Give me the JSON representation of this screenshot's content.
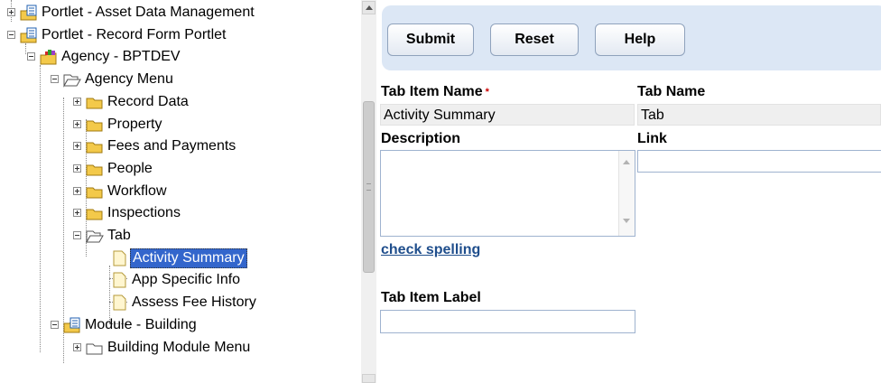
{
  "tree": {
    "nodes": [
      {
        "label": "Portlet - Asset Data Management",
        "icon": "portlet-icon",
        "expander": "plus"
      },
      {
        "label": "Portlet - Record Form Portlet",
        "icon": "portlet-icon",
        "expander": "minus"
      },
      {
        "label": "Agency - BPTDEV",
        "icon": "agency-folder-icon",
        "expander": "minus"
      },
      {
        "label": "Agency Menu",
        "icon": "folder-open-icon",
        "expander": "minus"
      },
      {
        "label": "Record Data",
        "icon": "folder-icon",
        "expander": "plus"
      },
      {
        "label": "Property",
        "icon": "folder-icon",
        "expander": "plus"
      },
      {
        "label": "Fees and Payments",
        "icon": "folder-icon",
        "expander": "plus"
      },
      {
        "label": "People",
        "icon": "folder-icon",
        "expander": "plus"
      },
      {
        "label": "Workflow",
        "icon": "folder-icon",
        "expander": "plus"
      },
      {
        "label": "Inspections",
        "icon": "folder-icon",
        "expander": "plus"
      },
      {
        "label": "Tab",
        "icon": "folder-open-icon",
        "expander": "minus"
      },
      {
        "label": "Activity Summary",
        "icon": "page-icon",
        "selected": true
      },
      {
        "label": "App Specific Info",
        "icon": "page-icon"
      },
      {
        "label": "Assess Fee History",
        "icon": "page-icon"
      },
      {
        "label": "Module - Building",
        "icon": "module-icon",
        "expander": "minus"
      },
      {
        "label": "Building Module Menu",
        "icon": "folder-outline-icon",
        "expander": "plus"
      }
    ]
  },
  "toolbar": {
    "submit_label": "Submit",
    "reset_label": "Reset",
    "help_label": "Help"
  },
  "form": {
    "tab_item_name_label": "Tab Item Name",
    "required_mark": "*",
    "tab_item_name_value": "Activity Summary",
    "tab_name_label": "Tab Name",
    "tab_name_value": "Tab",
    "description_label": "Description",
    "description_value": "",
    "link_label": "Link",
    "link_value": "",
    "check_spelling_label": "check spelling",
    "tab_item_label_label": "Tab Item Label",
    "tab_item_label_value": ""
  },
  "colors": {
    "toolbar_bg": "#dce7f5",
    "selection_bg": "#3366cc",
    "link_color": "#1f4e8c",
    "required_color": "#cc0000",
    "folder_yellow": "#f3c94a"
  }
}
